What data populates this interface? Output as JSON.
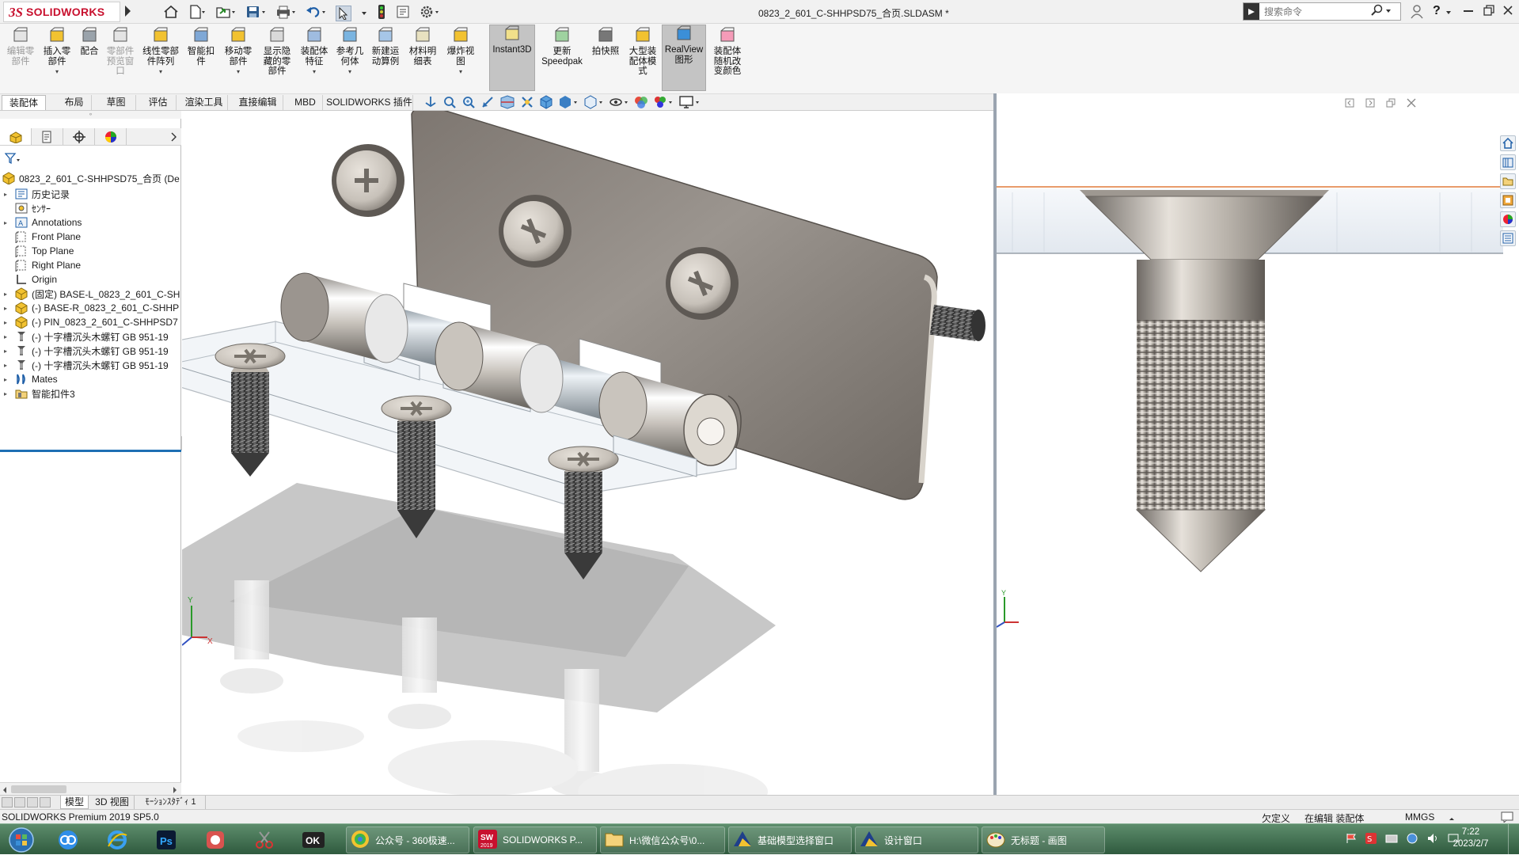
{
  "titlebar": {
    "brand": "SOLIDWORKS",
    "document_title": "0823_2_601_C-SHHPSD75_合页.SLDASM *",
    "search_placeholder": "搜索命令"
  },
  "ribbon": [
    {
      "label": "编辑零\n部件",
      "icon": "edit-component-icon",
      "disabled": true
    },
    {
      "label": "插入零\n部件",
      "icon": "insert-component-icon",
      "dropdown": true
    },
    {
      "label": "配合",
      "icon": "mate-icon"
    },
    {
      "label": "零部件\n预览窗\n口",
      "icon": "component-preview-icon",
      "disabled": true
    },
    {
      "label": "线性零部\n件阵列",
      "icon": "linear-pattern-icon",
      "dropdown": true
    },
    {
      "label": "智能扣\n件",
      "icon": "smart-fastener-icon"
    },
    {
      "label": "移动零\n部件",
      "icon": "move-component-icon",
      "dropdown": true
    },
    {
      "label": "显示隐\n藏的零\n部件",
      "icon": "show-hidden-icon"
    },
    {
      "label": "装配体\n特征",
      "icon": "assembly-feature-icon",
      "dropdown": true
    },
    {
      "label": "参考几\n何体",
      "icon": "reference-geometry-icon",
      "dropdown": true
    },
    {
      "label": "新建运\n动算例",
      "icon": "motion-study-icon"
    },
    {
      "label": "材料明\n细表",
      "icon": "bom-icon"
    },
    {
      "label": "爆炸视\n图",
      "icon": "exploded-view-icon",
      "dropdown": true
    },
    {
      "label": "Instant3D",
      "icon": "instant3d-icon",
      "active": true
    },
    {
      "label": "更新\nSpeedpak",
      "icon": "speedpak-icon"
    },
    {
      "label": "拍快照",
      "icon": "snapshot-icon"
    },
    {
      "label": "大型装\n配体模\n式",
      "icon": "large-assembly-icon"
    },
    {
      "label": "RealView\n图形",
      "icon": "realview-icon",
      "active": true
    },
    {
      "label": "装配体\n随机改\n变颜色",
      "icon": "random-color-icon"
    }
  ],
  "command_tabs": [
    "装配体",
    "布局",
    "草图",
    "评估",
    "渲染工具",
    "直接编辑",
    "MBD",
    "SOLIDWORKS 插件"
  ],
  "tree": {
    "root": "0823_2_601_C-SHHPSD75_合页  (De",
    "items": [
      {
        "label": "历史记录",
        "icon": "history-icon",
        "expand": true
      },
      {
        "label": "ｾﾝｻｰ",
        "icon": "sensor-icon",
        "expand": false
      },
      {
        "label": "Annotations",
        "icon": "annotations-icon",
        "expand": true
      },
      {
        "label": "Front Plane",
        "icon": "plane-icon",
        "expand": false
      },
      {
        "label": "Top Plane",
        "icon": "plane-icon",
        "expand": false
      },
      {
        "label": "Right Plane",
        "icon": "plane-icon",
        "expand": false
      },
      {
        "label": "Origin",
        "icon": "origin-icon",
        "expand": false
      },
      {
        "label": "(固定) BASE-L_0823_2_601_C-SH",
        "icon": "part-icon",
        "expand": true
      },
      {
        "label": "(-) BASE-R_0823_2_601_C-SHHP",
        "icon": "part-icon",
        "expand": true
      },
      {
        "label": "(-) PIN_0823_2_601_C-SHHPSD7",
        "icon": "part-icon",
        "expand": true
      },
      {
        "label": "(-) 十字槽沉头木螺钉 GB 951-19",
        "icon": "screw-icon",
        "expand": true
      },
      {
        "label": "(-) 十字槽沉头木螺钉 GB 951-19",
        "icon": "screw-icon",
        "expand": true
      },
      {
        "label": "(-) 十字槽沉头木螺钉 GB 951-19",
        "icon": "screw-icon",
        "expand": true
      },
      {
        "label": "Mates",
        "icon": "mates-icon",
        "expand": true
      },
      {
        "label": "智能扣件3",
        "icon": "smart-fastener-folder-icon",
        "expand": true
      }
    ]
  },
  "bottom_tabs": [
    "模型",
    "3D 视图",
    "ﾓｰｼｮﾝｽﾀﾃﾞｨ 1"
  ],
  "statusbar": {
    "product": "SOLIDWORKS Premium 2019 SP5.0",
    "state": "欠定义",
    "mode": "在编辑 装配体",
    "units": "MMGS"
  },
  "taskbar": {
    "tasks": [
      {
        "label": "公众号 - 360极速...",
        "icon": "browser-360-icon"
      },
      {
        "label": "SOLIDWORKS P...",
        "icon": "solidworks-app-icon"
      },
      {
        "label": "H:\\微信公众号\\0...",
        "icon": "folder-icon"
      },
      {
        "label": "基础模型选择窗口",
        "icon": "design-window-icon"
      },
      {
        "label": "设计窗口",
        "icon": "design-window-icon"
      },
      {
        "label": "无标题 - 画图",
        "icon": "paint-icon"
      }
    ],
    "time": "7:22",
    "date": "2023/2/7"
  },
  "colors": {
    "accent": "#c8102e",
    "taskbar": "#3f6f50",
    "viewport_select": "#1e6fb3"
  }
}
